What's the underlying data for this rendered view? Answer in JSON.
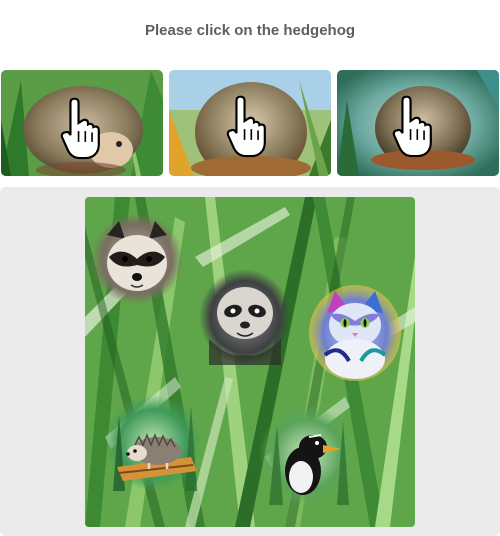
{
  "challenge": {
    "prompt": "Please click on the hedgehog"
  },
  "examples": [
    {
      "subject": "hedgehog",
      "cursor_icon": "hand-pointer-icon"
    },
    {
      "subject": "hedgehog",
      "cursor_icon": "hand-pointer-icon"
    },
    {
      "subject": "hedgehog",
      "cursor_icon": "hand-pointer-icon"
    }
  ],
  "canvas": {
    "background": "watercolor-grass",
    "animals": [
      {
        "kind": "raccoon"
      },
      {
        "kind": "sloth"
      },
      {
        "kind": "cat"
      },
      {
        "kind": "hedgehog"
      },
      {
        "kind": "penguin"
      }
    ]
  },
  "colors": {
    "prompt_text": "#5f5f5f",
    "panel_bg": "#ebebeb",
    "grass": "#4e9a3a"
  }
}
